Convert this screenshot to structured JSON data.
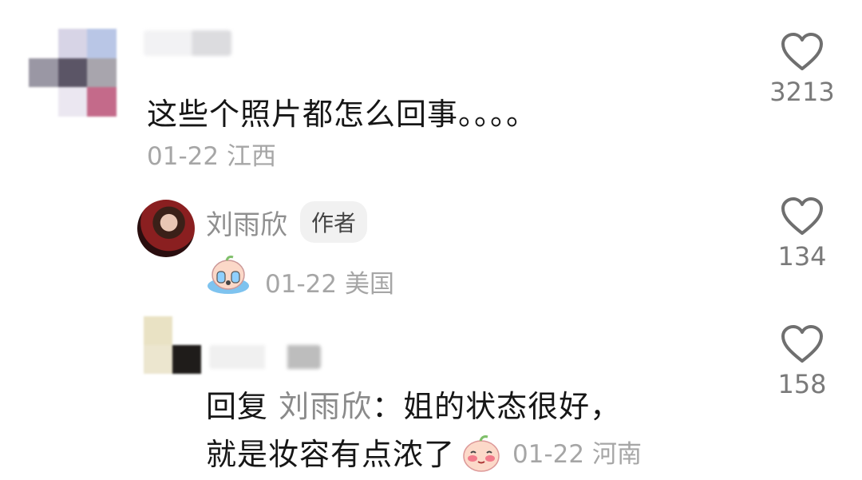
{
  "comments": [
    {
      "text": "这些个照片都怎么回事。。。。",
      "date": "01-22",
      "location": "江西",
      "likes": "3213"
    },
    {
      "username": "刘雨欣",
      "badge": "作者",
      "date": "01-22",
      "location": "美国",
      "likes": "134",
      "sticker": "crying-sticker"
    },
    {
      "reply_prefix": "回复",
      "reply_to": "刘雨欣",
      "line1_rest": "：姐的状态很好，",
      "line2": "就是妆容有点浓了",
      "date": "01-22",
      "location": "河南",
      "likes": "158",
      "sticker": "blushing-sticker"
    }
  ],
  "colors": {
    "text_main": "#161616",
    "text_meta": "#a6a6a6",
    "like_icon": "#6f6f6f"
  },
  "icons": [
    "heart-outline-icon",
    "crying-sticker",
    "blushing-sticker"
  ]
}
